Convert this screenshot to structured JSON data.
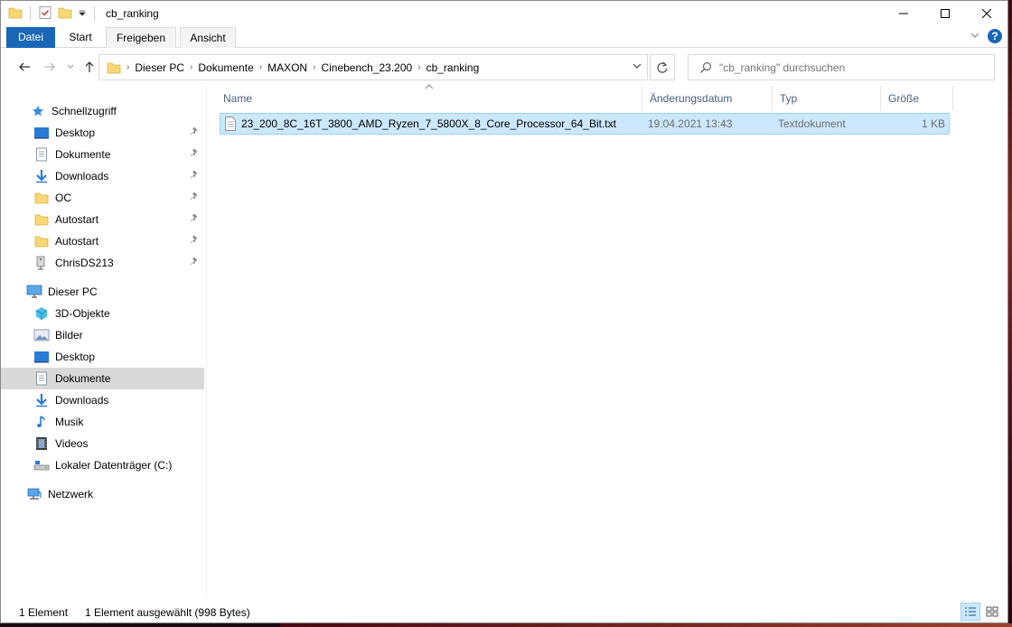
{
  "window": {
    "title": "cb_ranking"
  },
  "ribbon": {
    "tabs": [
      "Datei",
      "Start",
      "Freigeben",
      "Ansicht"
    ]
  },
  "address": {
    "crumbs": [
      "Dieser PC",
      "Dokumente",
      "MAXON",
      "Cinebench_23.200",
      "cb_ranking"
    ]
  },
  "search": {
    "placeholder": "\"cb_ranking\" durchsuchen"
  },
  "sidebar": {
    "quick_access": "Schnellzugriff",
    "quick_items": [
      {
        "label": "Desktop",
        "icon": "desktop-icon"
      },
      {
        "label": "Dokumente",
        "icon": "documents-icon"
      },
      {
        "label": "Downloads",
        "icon": "downloads-icon"
      },
      {
        "label": "OC",
        "icon": "folder-icon"
      },
      {
        "label": "Autostart",
        "icon": "folder-icon"
      },
      {
        "label": "Autostart",
        "icon": "folder-icon"
      },
      {
        "label": "ChrisDS213",
        "icon": "network-drive-icon"
      }
    ],
    "this_pc": "Dieser PC",
    "pc_items": [
      {
        "label": "3D-Objekte",
        "icon": "3d-objects-icon"
      },
      {
        "label": "Bilder",
        "icon": "pictures-icon"
      },
      {
        "label": "Desktop",
        "icon": "desktop-icon"
      },
      {
        "label": "Dokumente",
        "icon": "documents-icon"
      },
      {
        "label": "Downloads",
        "icon": "downloads-icon"
      },
      {
        "label": "Musik",
        "icon": "music-icon"
      },
      {
        "label": "Videos",
        "icon": "videos-icon"
      },
      {
        "label": "Lokaler Datenträger (C:)",
        "icon": "local-disk-icon"
      }
    ],
    "network": "Netzwerk",
    "selected": "Dokumente"
  },
  "columns": {
    "name": "Name",
    "date": "Änderungsdatum",
    "type": "Typ",
    "size": "Größe"
  },
  "files": [
    {
      "name": "23_200_8C_16T_3800_AMD_Ryzen_7_5800X_8_Core_Processor_64_Bit.txt",
      "date": "19.04.2021 13:43",
      "type": "Textdokument",
      "size": "1 KB"
    }
  ],
  "status": {
    "count": "1 Element",
    "selection": "1 Element ausgewählt (998 Bytes)"
  },
  "colors": {
    "accent": "#1a66b7",
    "selection_bg": "#cce8ff",
    "selection_border": "#99d1ff",
    "column_header_text": "#4c607a"
  }
}
